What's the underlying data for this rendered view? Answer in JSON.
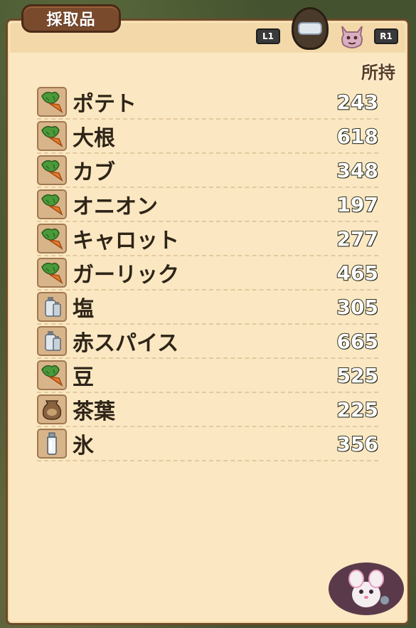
{
  "window": {
    "title": "採取品",
    "shoulder_left": "L1",
    "shoulder_right": "R1",
    "owned_header": "所持"
  },
  "category_icons": [
    {
      "name": "cooking-pot-icon",
      "active": true
    },
    {
      "name": "monster-icon",
      "active": false
    }
  ],
  "items": [
    {
      "name": "ポテト",
      "count": "243",
      "icon": "vegetable-icon"
    },
    {
      "name": "大根",
      "count": "618",
      "icon": "vegetable-icon"
    },
    {
      "name": "カブ",
      "count": "348",
      "icon": "vegetable-icon"
    },
    {
      "name": "オニオン",
      "count": "197",
      "icon": "vegetable-icon"
    },
    {
      "name": "キャロット",
      "count": "277",
      "icon": "vegetable-icon"
    },
    {
      "name": "ガーリック",
      "count": "465",
      "icon": "vegetable-icon"
    },
    {
      "name": "塩",
      "count": "305",
      "icon": "spice-jars-icon"
    },
    {
      "name": "赤スパイス",
      "count": "665",
      "icon": "spice-jars-icon"
    },
    {
      "name": "豆",
      "count": "525",
      "icon": "vegetable-icon"
    },
    {
      "name": "茶葉",
      "count": "225",
      "icon": "sack-icon"
    },
    {
      "name": "氷",
      "count": "356",
      "icon": "bottle-icon"
    }
  ],
  "colors": {
    "panel_bg": "#fbe8c2",
    "panel_border": "#6b4a2b",
    "title_tab": "#7a4a2c",
    "item_text": "#2e2418"
  }
}
